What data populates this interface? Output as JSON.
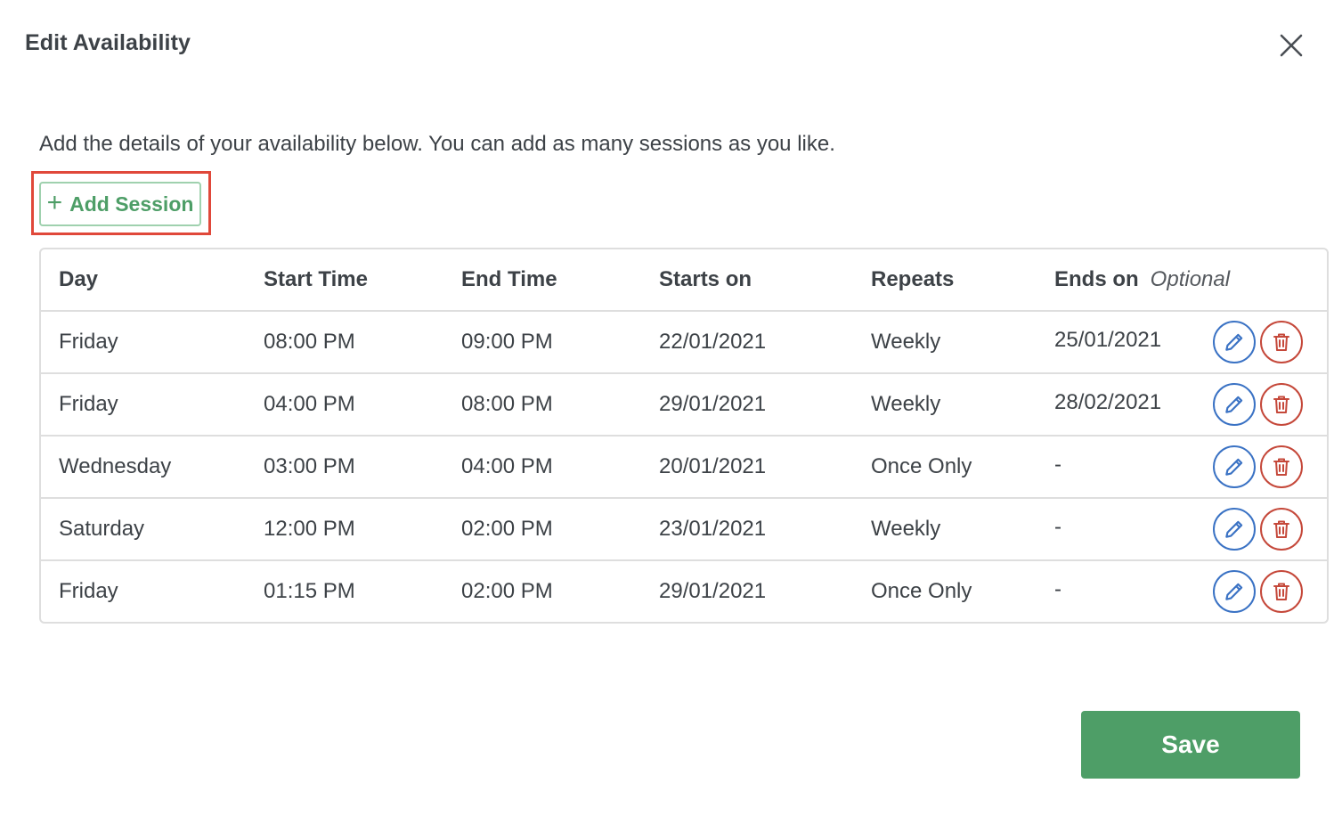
{
  "dialog": {
    "title": "Edit Availability",
    "close_icon": "close-icon",
    "intro_text": "Add the details of your availability below. You can add as many sessions as you like."
  },
  "add_session": {
    "icon": "plus-icon",
    "label": "Add Session",
    "accent_color": "#4e9e67",
    "highlight_color": "#e0483a"
  },
  "table": {
    "headers": {
      "day": "Day",
      "start_time": "Start Time",
      "end_time": "End Time",
      "starts_on": "Starts on",
      "repeats": "Repeats",
      "ends_on": "Ends on",
      "ends_on_hint": "Optional"
    },
    "rows": [
      {
        "day": "Friday",
        "start_time": "08:00 PM",
        "end_time": "09:00 PM",
        "starts_on": "22/01/2021",
        "repeats": "Weekly",
        "ends_on": "25/01/2021"
      },
      {
        "day": "Friday",
        "start_time": "04:00 PM",
        "end_time": "08:00 PM",
        "starts_on": "29/01/2021",
        "repeats": "Weekly",
        "ends_on": "28/02/2021"
      },
      {
        "day": "Wednesday",
        "start_time": "03:00 PM",
        "end_time": "04:00 PM",
        "starts_on": "20/01/2021",
        "repeats": "Once Only",
        "ends_on": "-"
      },
      {
        "day": "Saturday",
        "start_time": "12:00 PM",
        "end_time": "02:00 PM",
        "starts_on": "23/01/2021",
        "repeats": "Weekly",
        "ends_on": "-"
      },
      {
        "day": "Friday",
        "start_time": "01:15 PM",
        "end_time": "02:00 PM",
        "starts_on": "29/01/2021",
        "repeats": "Once Only",
        "ends_on": "-"
      }
    ],
    "row_actions": {
      "edit_icon": "pencil-icon",
      "delete_icon": "trash-icon",
      "edit_color": "#3a72c4",
      "delete_color": "#c5483a"
    }
  },
  "footer": {
    "save_label": "Save",
    "save_color": "#4e9e67"
  }
}
